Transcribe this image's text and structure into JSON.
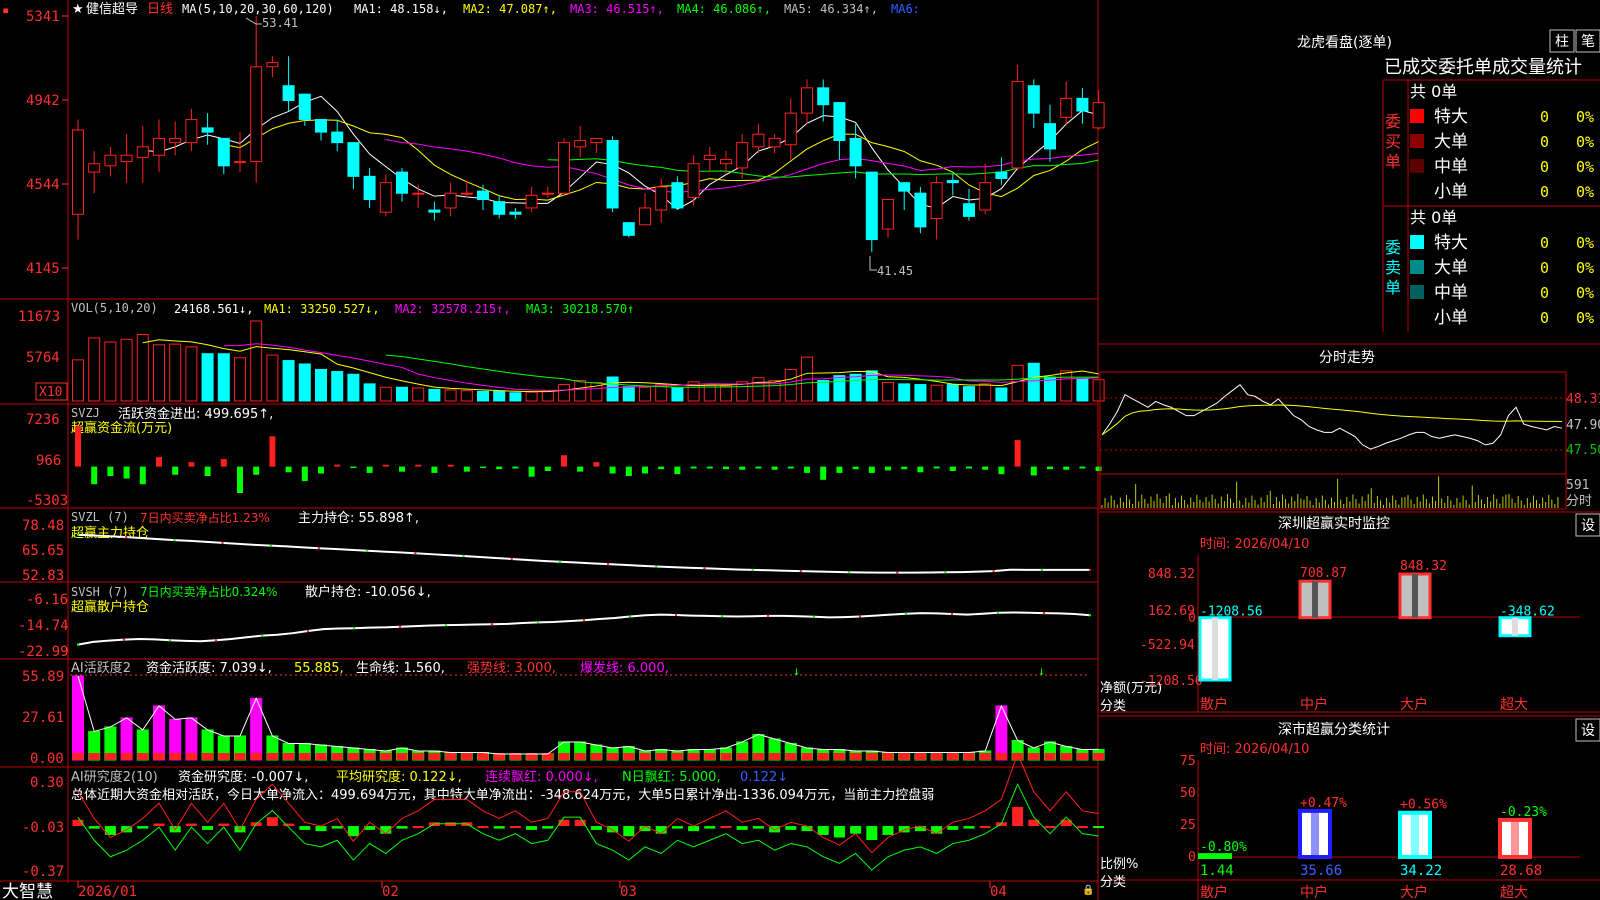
{
  "header": {
    "marker": "▪",
    "star": "★",
    "stock_name": "健信超导",
    "period": "日线",
    "ma_spec": "MA(5,10,20,30,60,120)",
    "ma1": "MA1: 48.158↓,",
    "ma2": "MA2: 47.087↑,",
    "ma3": "MA3: 46.515↑,",
    "ma4": "MA4: 46.086↑,",
    "ma5": "MA5: 46.334↑,",
    "ma6": "MA6:",
    "high_label": "53.41",
    "low_label": "41.45"
  },
  "price_axis": [
    "5341",
    "4942",
    "4544",
    "4145"
  ],
  "vol_panel": {
    "header": "VOL(5,10,20)",
    "value": "24168.561↓,",
    "ma1": "MA1: 33250.527↓,",
    "ma2": "MA2: 32578.215↑,",
    "ma3": "MA3: 30218.570↑",
    "axis": [
      "11673",
      "5764"
    ],
    "unit": "X10"
  },
  "svzj_panel": {
    "header": "SVZJ",
    "label": "活跃资金进出: 499.695↑,",
    "subtitle": "超赢资金流(万元)",
    "axis": [
      "7236",
      "966",
      "-5303"
    ]
  },
  "svzl_panel": {
    "header": "SVZL (7)",
    "label1": "7日内买卖净占比1.23%",
    "label2": "主力持仓: 55.898↑,",
    "subtitle": "超赢主力持仓",
    "axis": [
      "78.48",
      "65.65",
      "52.83"
    ]
  },
  "svsh_panel": {
    "header": "SVSH (7)",
    "label1": "7日内买卖净占比0.324%",
    "label2": "散户持仓: -10.056↓,",
    "subtitle": "超赢散户持仓",
    "axis": [
      "-6.16",
      "-14.74",
      "-22.99"
    ]
  },
  "ai_panel": {
    "header": "AI活跃度2",
    "label1": "资金活跃度: 7.039↓,",
    "label2": "55.885,",
    "label3": "生命线: 1.560,",
    "label4": "强势线: 3.000,",
    "label5": "爆发线: 6.000,",
    "axis": [
      "55.89",
      "27.61",
      "0.00"
    ]
  },
  "research_panel": {
    "header": "AI研究度2(10)",
    "label1": "资金研究度: -0.007↓,",
    "label2": "平均研究度: 0.122↓,",
    "label3": "连续飘红: 0.000↓,",
    "label4": "N日飘红: 5.000,",
    "label5": "0.122↓",
    "summary": "总体近期大资金相对活跃，今日大单净流入：499.694万元，其中特大单净流出：-348.624万元，大单5日累计净出-1336.094万元，当前主力控盘弱",
    "axis": [
      "0.30",
      "-0.03",
      "-0.37"
    ]
  },
  "bottom": {
    "brand": "大智慧",
    "dates": [
      "2026/01",
      "02",
      "03",
      "04"
    ]
  },
  "right": {
    "title": "龙虎看盘(逐单)",
    "btn1": "柱",
    "btn2": "笔",
    "stats_title": "已成交委托单成交量统计",
    "buy": {
      "side_label": "委买单",
      "total": "共 0单",
      "rows": [
        {
          "label": "特大",
          "count": "0",
          "pct": "0%",
          "color": "#ff0000"
        },
        {
          "label": "大单",
          "count": "0",
          "pct": "0%",
          "color": "#8b0000"
        },
        {
          "label": "中单",
          "count": "0",
          "pct": "0%",
          "color": "#5a0000"
        },
        {
          "label": "小单",
          "count": "0",
          "pct": "0%",
          "color": null
        }
      ]
    },
    "sell": {
      "side_label": "委卖单",
      "total": "共 0单",
      "rows": [
        {
          "label": "特大",
          "count": "0",
          "pct": "0%",
          "color": "#00ffff"
        },
        {
          "label": "大单",
          "count": "0",
          "pct": "0%",
          "color": "#008b8b"
        },
        {
          "label": "中单",
          "count": "0",
          "pct": "0%",
          "color": "#006060"
        },
        {
          "label": "小单",
          "count": "0",
          "pct": "0%",
          "color": null
        }
      ]
    },
    "intraday": {
      "title": "分时走势",
      "axis": [
        "48.31",
        "47.90",
        "47.50"
      ],
      "vol_value": "591",
      "vol_unit": "分时"
    },
    "sz_monitor": {
      "title": "深圳超赢实时监控",
      "settings": "设",
      "time": "时间: 2026/04/10",
      "axis": [
        "848.32",
        "162.69",
        "0",
        "-522.94",
        "-1208.56"
      ],
      "y_title": "净额(万元)",
      "x_title": "分类",
      "categories": [
        "散户",
        "中户",
        "大户",
        "超大"
      ],
      "value_labels": [
        "-1208.56",
        "708.87",
        "848.32",
        "-348.62"
      ]
    },
    "sz_category": {
      "title": "深市超赢分类统计",
      "settings": "设",
      "time": "时间: 2026/04/10",
      "axis": [
        "75",
        "50",
        "25",
        "0"
      ],
      "y_title": "比例%",
      "x_title": "分类",
      "categories": [
        "散户",
        "中户",
        "大户",
        "超大"
      ],
      "change_labels": [
        "-0.80%",
        "+0.47%",
        "+0.56%",
        "-0.23%"
      ],
      "value_labels": [
        "1.44",
        "35.66",
        "34.22",
        "28.68"
      ]
    }
  },
  "chart_data": [
    {
      "type": "candlestick",
      "title": "健信超导 日线",
      "ylim": [
        41.45,
        53.41
      ],
      "candles": [
        [
          44.0,
          48.0,
          42.8,
          48.5
        ],
        [
          46.0,
          46.4,
          45.0,
          47.0
        ],
        [
          46.3,
          46.8,
          45.8,
          47.2
        ],
        [
          46.5,
          46.8,
          45.5,
          47.8
        ],
        [
          46.7,
          47.2,
          45.5,
          48.2
        ],
        [
          46.8,
          47.6,
          46.0,
          48.5
        ],
        [
          47.4,
          47.6,
          46.8,
          48.4
        ],
        [
          47.4,
          48.5,
          47.0,
          49.0
        ],
        [
          48.1,
          47.9,
          47.3,
          48.8
        ],
        [
          47.6,
          46.3,
          45.9,
          47.6
        ],
        [
          46.5,
          46.5,
          46.0,
          47.9
        ],
        [
          46.5,
          51.0,
          45.5,
          53.41
        ],
        [
          51.0,
          51.2,
          50.5,
          51.5
        ],
        [
          50.1,
          49.4,
          48.9,
          51.5
        ],
        [
          49.7,
          48.5,
          48.2,
          49.7
        ],
        [
          48.5,
          47.9,
          47.5,
          48.5
        ],
        [
          47.9,
          47.4,
          47.0,
          48.5
        ],
        [
          47.4,
          45.8,
          45.2,
          47.4
        ],
        [
          45.8,
          44.7,
          44.3,
          46.2
        ],
        [
          44.1,
          45.5,
          43.9,
          45.9
        ],
        [
          46.0,
          45.0,
          44.6,
          46.2
        ],
        [
          45.0,
          45.0,
          44.3,
          45.4
        ],
        [
          44.2,
          44.1,
          43.7,
          44.6
        ],
        [
          44.3,
          45.0,
          43.9,
          45.5
        ],
        [
          45.0,
          45.0,
          44.8,
          45.6
        ],
        [
          45.1,
          44.7,
          44.2,
          45.4
        ],
        [
          44.6,
          44.0,
          43.8,
          44.9
        ],
        [
          44.1,
          44.0,
          43.8,
          44.3
        ],
        [
          44.3,
          44.9,
          44.1,
          45.3
        ],
        [
          45.0,
          45.0,
          44.8,
          45.3
        ],
        [
          45.0,
          47.4,
          44.9,
          47.6
        ],
        [
          47.2,
          47.5,
          46.7,
          48.2
        ],
        [
          47.4,
          47.6,
          46.9,
          47.6
        ],
        [
          47.5,
          44.3,
          44.1,
          47.7
        ],
        [
          43.6,
          43.0,
          42.9,
          43.6
        ],
        [
          43.5,
          44.3,
          43.5,
          45.0
        ],
        [
          44.2,
          45.3,
          43.6,
          45.7
        ],
        [
          45.5,
          44.3,
          44.2,
          45.8
        ],
        [
          44.8,
          46.4,
          44.4,
          46.8
        ],
        [
          46.6,
          46.8,
          46.0,
          47.2
        ],
        [
          46.4,
          46.6,
          45.9,
          47.0
        ],
        [
          46.2,
          47.4,
          45.7,
          47.8
        ],
        [
          47.2,
          47.8,
          46.9,
          48.3
        ],
        [
          47.2,
          47.6,
          46.9,
          47.8
        ],
        [
          47.3,
          48.8,
          46.6,
          49.5
        ],
        [
          48.8,
          50.0,
          48.3,
          50.4
        ],
        [
          50.0,
          49.2,
          48.4,
          50.4
        ],
        [
          49.3,
          47.5,
          46.6,
          49.3
        ],
        [
          47.6,
          46.3,
          45.7,
          48.3
        ],
        [
          46.0,
          42.8,
          42.2,
          46.0
        ],
        [
          43.3,
          44.7,
          42.9,
          44.7
        ],
        [
          45.5,
          45.1,
          44.2,
          45.5
        ],
        [
          45.0,
          43.4,
          43.1,
          45.3
        ],
        [
          43.8,
          45.5,
          42.8,
          45.8
        ],
        [
          45.6,
          45.5,
          44.9,
          45.9
        ],
        [
          44.5,
          43.9,
          43.7,
          45.2
        ],
        [
          44.2,
          45.5,
          44.0,
          46.4
        ],
        [
          46.0,
          45.7,
          45.4,
          46.7
        ],
        [
          46.2,
          50.3,
          46.1,
          51.1
        ],
        [
          50.1,
          48.8,
          48.1,
          50.4
        ],
        [
          48.3,
          47.1,
          46.5,
          49.2
        ],
        [
          48.6,
          49.5,
          48.2,
          50.3
        ],
        [
          49.5,
          48.9,
          48.3,
          50.0
        ],
        [
          48.1,
          49.3,
          48.0,
          49.9
        ]
      ]
    },
    {
      "type": "bar",
      "title": "VOL(5,10,20)",
      "ylim": [
        0,
        11673
      ],
      "values": [
        6000,
        9200,
        8600,
        9000,
        9700,
        8200,
        8300,
        7900,
        6900,
        6900,
        6300,
        11673,
        6700,
        5900,
        5400,
        4600,
        4300,
        3900,
        2500,
        2000,
        2000,
        1900,
        1700,
        1600,
        1500,
        1400,
        1400,
        1200,
        1300,
        1500,
        2400,
        3000,
        2700,
        3500,
        2100,
        2000,
        2400,
        1900,
        2800,
        2400,
        2200,
        2800,
        3400,
        3000,
        4600,
        6400,
        3000,
        3700,
        3900,
        4400,
        2700,
        2500,
        2400,
        2300,
        2400,
        2100,
        2500,
        1900,
        5200,
        5500,
        3500,
        4400,
        3300,
        3100
      ],
      "series_ma": [
        "MA1",
        "MA2",
        "MA3"
      ]
    },
    {
      "type": "bar",
      "title": "SVZJ 活跃资金进出",
      "ylim": [
        -5303,
        7236
      ],
      "values": [
        6500,
        -2800,
        -1500,
        -1900,
        -2800,
        1500,
        -1300,
        700,
        -1500,
        1200,
        -4200,
        -1300,
        4800,
        -900,
        -2300,
        -1100,
        300,
        -100,
        -1000,
        300,
        -800,
        300,
        -1000,
        300,
        -800,
        -200,
        -400,
        -300,
        -1600,
        -700,
        1800,
        -800,
        700,
        -1100,
        -1500,
        -1100,
        -400,
        -1200,
        -300,
        -300,
        -400,
        -500,
        -300,
        -500,
        -300,
        -1000,
        -2100,
        -1000,
        -400,
        -1000,
        -600,
        -400,
        -900,
        -300,
        -700,
        -300,
        -500,
        -1200,
        4200,
        -1400,
        -400,
        -500,
        -300,
        -700
      ]
    },
    {
      "type": "line",
      "title": "SVZL 主力持仓",
      "ylim": [
        52.83,
        78.48
      ],
      "values": [
        73.6,
        73.2,
        72.8,
        72.4,
        71.9,
        71.4,
        70.9,
        70.5,
        70.0,
        69.5,
        69.0,
        68.5,
        68.1,
        67.7,
        67.2,
        66.8,
        66.4,
        66.0,
        65.5,
        65.1,
        64.7,
        64.3,
        63.8,
        63.3,
        62.9,
        62.4,
        61.9,
        61.4,
        60.9,
        60.4,
        60.0,
        59.6,
        59.2,
        58.8,
        58.4,
        58.0,
        57.6,
        57.3,
        57.0,
        56.7,
        56.4,
        56.1,
        55.9,
        55.7,
        55.5,
        55.3,
        55.1,
        54.9,
        54.7,
        54.6,
        54.5,
        54.5,
        54.5,
        54.6,
        54.7,
        54.8,
        55.0,
        55.3,
        56.0,
        55.9,
        55.9,
        55.9,
        55.9,
        55.9
      ]
    },
    {
      "type": "line",
      "title": "SVSH 散户持仓",
      "ylim": [
        -22.99,
        -6.16
      ],
      "values": [
        -20.6,
        -19.7,
        -19.3,
        -19.0,
        -18.8,
        -18.9,
        -19.2,
        -19.4,
        -19.5,
        -19.2,
        -18.8,
        -18.2,
        -17.7,
        -17.4,
        -16.9,
        -16.2,
        -15.6,
        -15.4,
        -15.3,
        -15.1,
        -15.0,
        -14.8,
        -14.6,
        -14.4,
        -14.3,
        -14.2,
        -14.1,
        -14.0,
        -13.9,
        -13.6,
        -13.4,
        -13.3,
        -13.0,
        -12.7,
        -12.3,
        -12.0,
        -11.5,
        -11.1,
        -10.9,
        -11.0,
        -11.2,
        -11.3,
        -11.4,
        -11.5,
        -11.4,
        -11.3,
        -11.3,
        -11.4,
        -11.6,
        -11.8,
        -11.7,
        -11.5,
        -11.2,
        -10.9,
        -10.6,
        -10.4,
        -10.5,
        -10.7,
        -10.9,
        -10.6,
        -10.3,
        -10.2,
        -10.3,
        -10.4,
        -10.5,
        -10.7,
        -11.1
      ]
    },
    {
      "type": "bar",
      "title": "AI活跃度2",
      "ylim": [
        0,
        55.89
      ],
      "values": [
        55.89,
        19.0,
        22.0,
        28.0,
        20.0,
        36.0,
        27.0,
        28.0,
        20.0,
        16.0,
        16.0,
        41.0,
        16.0,
        11.0,
        11.0,
        10.0,
        9.0,
        8.0,
        7.0,
        6.0,
        8.0,
        6.0,
        6.0,
        5.0,
        5.0,
        5.0,
        4.0,
        4.0,
        4.0,
        4.0,
        12.0,
        12.0,
        10.0,
        8.0,
        9.0,
        6.0,
        7.0,
        6.0,
        7.0,
        7.0,
        8.0,
        12.0,
        17.0,
        14.0,
        11.0,
        8.0,
        7.0,
        7.0,
        6.0,
        6.0,
        5.0,
        5.0,
        5.0,
        5.0,
        5.0,
        5.0,
        6.0,
        36.0,
        13.0,
        8.0,
        12.0,
        9.0,
        7.0,
        7.039
      ]
    },
    {
      "type": "bar",
      "title": "AI研究度2(10)",
      "ylim": [
        -0.37,
        0.3
      ],
      "values": [
        0.05,
        -0.02,
        -0.07,
        -0.05,
        -0.02,
        0.02,
        -0.05,
        0.02,
        -0.03,
        0.02,
        -0.05,
        0.03,
        0.07,
        0.02,
        -0.03,
        -0.04,
        -0.02,
        -0.08,
        -0.03,
        -0.06,
        -0.02,
        0.0,
        0.03,
        0.03,
        0.03,
        0.0,
        -0.02,
        0.0,
        -0.03,
        -0.02,
        0.05,
        0.05,
        -0.03,
        -0.05,
        -0.08,
        -0.04,
        -0.06,
        -0.02,
        -0.04,
        -0.02,
        0.0,
        -0.03,
        -0.02,
        -0.05,
        -0.03,
        -0.04,
        -0.07,
        -0.09,
        -0.06,
        -0.11,
        -0.07,
        -0.05,
        -0.04,
        -0.06,
        -0.03,
        -0.02,
        0.0,
        0.03,
        0.15,
        0.05,
        0.0,
        0.05,
        0.0,
        -0.007
      ]
    },
    {
      "type": "line",
      "title": "分时走势",
      "ylim": [
        47.5,
        48.31
      ],
      "values": [
        47.82,
        47.95,
        48.1,
        48.3,
        48.25,
        48.2,
        48.15,
        48.22,
        48.18,
        48.15,
        48.1,
        48.05,
        48.05,
        48.1,
        48.15,
        48.2,
        48.28,
        48.35,
        48.42,
        48.3,
        48.28,
        48.22,
        48.18,
        48.25,
        48.15,
        48.05,
        48.0,
        47.92,
        47.88,
        47.85,
        47.85,
        47.9,
        47.85,
        47.8,
        47.7,
        47.65,
        47.68,
        47.72,
        47.75,
        47.78,
        47.82,
        47.85,
        47.85,
        47.8,
        47.78,
        47.8,
        47.82,
        47.8,
        47.78,
        47.75,
        47.7,
        47.72,
        47.82,
        48.05,
        48.15,
        47.95,
        47.92,
        47.9,
        47.88,
        47.92,
        47.9
      ]
    },
    {
      "type": "bar",
      "title": "深圳超赢实时监控",
      "ylabel": "净额(万元)",
      "xlabel": "分类",
      "categories": [
        "散户",
        "中户",
        "大户",
        "超大"
      ],
      "values": [
        -1208.56,
        708.87,
        848.32,
        -348.62
      ],
      "ylim": [
        -1208.56,
        848.32
      ]
    },
    {
      "type": "bar",
      "title": "深市超赢分类统计",
      "ylabel": "比例%",
      "xlabel": "分类",
      "categories": [
        "散户",
        "中户",
        "大户",
        "超大"
      ],
      "values": [
        1.44,
        35.66,
        34.22,
        28.68
      ],
      "changes": [
        "-0.80%",
        "+0.47%",
        "+0.56%",
        "-0.23%"
      ],
      "ylim": [
        0,
        75
      ]
    }
  ],
  "colors": {
    "up": "#ff2020",
    "down": "#00ffff",
    "frame": "#c00000",
    "ma1": "#ffffff",
    "ma2": "#ffff00",
    "ma3": "#ff00ff",
    "ma4": "#00ff00",
    "green_bar": "#00ff00",
    "magenta_bar": "#ff00ff",
    "label_yellow": "#ffff00",
    "label_orange": "#ff8800"
  }
}
